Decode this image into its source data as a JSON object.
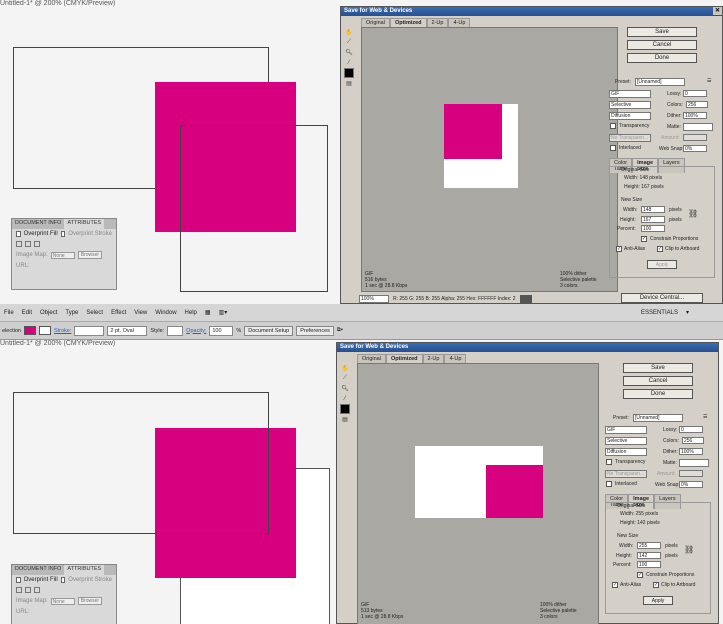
{
  "doc_title": "Untitled-1* @ 200% (CMYK/Preview)",
  "colors": {
    "magenta": "#d7007f",
    "canvas_gray": "#a9a8a3",
    "dialog_bg": "#d4d0c8"
  },
  "attributes_panel": {
    "tab_doc_info": "DOCUMENT INFO",
    "tab_attributes": "ATTRIBUTES",
    "overprint_fill": "Overprint Fill",
    "overprint_stroke": "Overprint Stroke",
    "image_map_label": "Image Map:",
    "image_map_value": "None",
    "browser_button": "Browser",
    "url_label": "URL:"
  },
  "menubar": {
    "items": [
      "File",
      "Edit",
      "Object",
      "Type",
      "Select",
      "Effect",
      "View",
      "Window",
      "Help"
    ],
    "essentials": "ESSENTIALS"
  },
  "control_bar": {
    "selection": "election",
    "stroke_label": "Stroke:",
    "brush": "2 pt. Oval",
    "style_label": "Style:",
    "opacity_label": "Opacity:",
    "opacity_value": "100",
    "opacity_unit": "%",
    "document_setup": "Document Setup",
    "preferences": "Preferences"
  },
  "dialog_top": {
    "title": "Save for Web & Devices",
    "tabs": [
      "Original",
      "Optimized",
      "2-Up",
      "4-Up"
    ],
    "buttons": {
      "save": "Save",
      "cancel": "Cancel",
      "done": "Done",
      "device_central": "Device Central...",
      "apply": "Apply"
    },
    "preset_label": "Preset:",
    "preset_value": "[Unnamed]",
    "format": "GIF",
    "lossy_label": "Lossy:",
    "lossy_value": "0",
    "reduction": "Selective",
    "colors_label": "Colors:",
    "colors_value": "256",
    "dither_algo": "Diffusion",
    "dither_label": "Dither:",
    "dither_value": "100%",
    "transparency": "Transparency",
    "matte_label": "Matte:",
    "no_transparency": "No Transparen...",
    "amount_label": "Amount:",
    "interlaced": "Interlaced",
    "websnap_label": "Web Snap:",
    "websnap_value": "0%",
    "sub_tabs": [
      "Color Table",
      "Image Size",
      "Layers"
    ],
    "original_size": "Original Size",
    "orig_width": "Width: 148 pixels",
    "orig_height": "Height: 167 pixels",
    "new_size": "New Size",
    "width_label": "Width:",
    "width_value": "148",
    "height_label": "Height:",
    "height_value": "167",
    "pixels": "pixels",
    "percent_label": "Percent:",
    "percent_value": "100",
    "constrain": "Constrain Proportions",
    "antialias": "Anti-Alias",
    "clip": "Clip to Artboard",
    "stat_left": [
      "GIF",
      "516 bytes",
      "1 sec @ 28.8 Kbps"
    ],
    "stat_right": [
      "100% dither",
      "Selective palette",
      "3 colors"
    ],
    "zoom": "100%",
    "readout": "R: 255   G: 255   B: 255   Alpha: 255   Hex: FFFFFF   Index: 2"
  },
  "dialog_bottom": {
    "title": "Save for Web & Devices",
    "tabs": [
      "Original",
      "Optimized",
      "2-Up",
      "4-Up"
    ],
    "buttons": {
      "save": "Save",
      "cancel": "Cancel",
      "done": "Done",
      "apply": "Apply"
    },
    "preset_label": "Preset:",
    "preset_value": "[Unnamed]",
    "format": "GIF",
    "lossy_label": "Lossy:",
    "lossy_value": "0",
    "reduction": "Selective",
    "colors_label": "Colors:",
    "colors_value": "256",
    "dither_algo": "Diffusion",
    "dither_label": "Dither:",
    "dither_value": "100%",
    "transparency": "Transparency",
    "matte_label": "Matte:",
    "no_transparency": "No Transparen...",
    "amount_label": "Amount:",
    "interlaced": "Interlaced",
    "websnap_label": "Web Snap:",
    "websnap_value": "0%",
    "sub_tabs": [
      "Color Table",
      "Image Size",
      "Layers"
    ],
    "original_size": "Original Size",
    "orig_width": "Width: 255 pixels",
    "orig_height": "Height: 142 pixels",
    "new_size": "New Size",
    "width_label": "Width:",
    "width_value": "255",
    "height_label": "Height:",
    "height_value": "142",
    "pixels": "pixels",
    "percent_label": "Percent:",
    "percent_value": "100",
    "constrain": "Constrain Proportions",
    "antialias": "Anti-Alias",
    "clip": "Clip to Artboard",
    "stat_left": [
      "GIF",
      "513 bytes",
      "1 sec @ 28.8 Kbps"
    ],
    "stat_right": [
      "100% dither",
      "Selective palette",
      "3 colors"
    ]
  }
}
